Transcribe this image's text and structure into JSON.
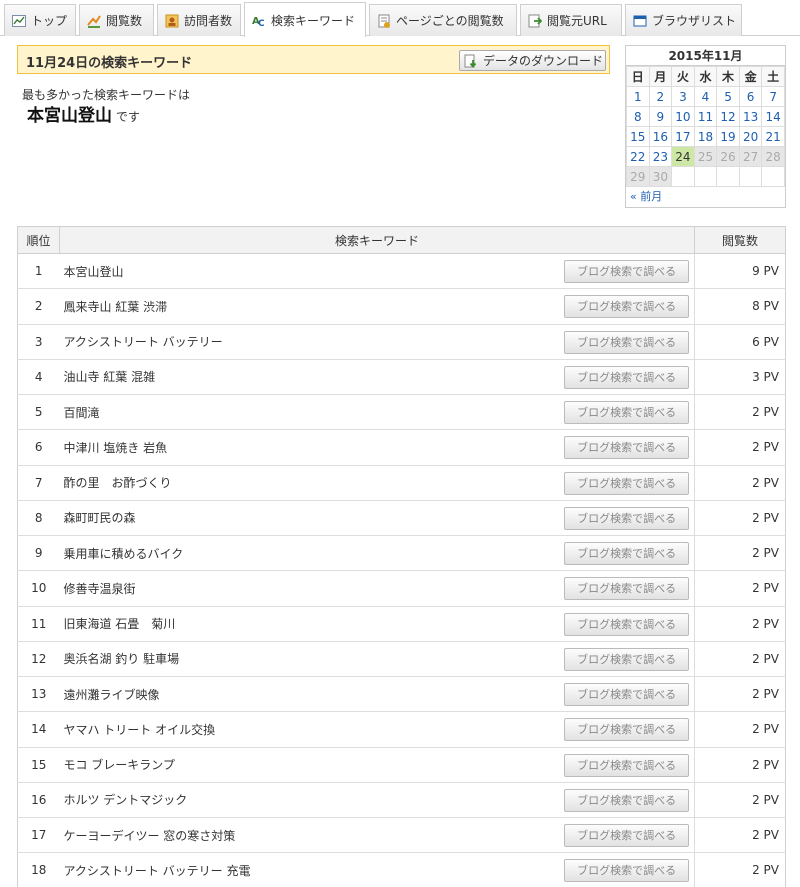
{
  "tabs": [
    {
      "label": "トップ",
      "icon": "chart-line-icon",
      "active": false
    },
    {
      "label": "閲覧数",
      "icon": "pageviews-icon",
      "active": false
    },
    {
      "label": "訪問者数",
      "icon": "visitors-icon",
      "active": false
    },
    {
      "label": "検索キーワード",
      "icon": "keyword-icon",
      "active": true
    },
    {
      "label": "ページごとの閲覧数",
      "icon": "page-icon",
      "active": false
    },
    {
      "label": "閲覧元URL",
      "icon": "referrer-icon",
      "active": false
    },
    {
      "label": "ブラウザリスト",
      "icon": "browser-icon",
      "active": false
    }
  ],
  "header": {
    "title": "11月24日の検索キーワード",
    "download_label": "データのダウンロード"
  },
  "summary": {
    "line1": "最も多かった検索キーワードは",
    "top_keyword": "本宮山登山",
    "suffix": "です"
  },
  "calendar": {
    "title": "2015年11月",
    "weekdays": [
      "日",
      "月",
      "火",
      "水",
      "木",
      "金",
      "土"
    ],
    "weeks": [
      [
        "1",
        "2",
        "3",
        "4",
        "5",
        "6",
        "7"
      ],
      [
        "8",
        "9",
        "10",
        "11",
        "12",
        "13",
        "14"
      ],
      [
        "15",
        "16",
        "17",
        "18",
        "19",
        "20",
        "21"
      ],
      [
        "22",
        "23",
        "24",
        "25",
        "26",
        "27",
        "28"
      ],
      [
        "29",
        "30",
        "",
        "",
        "",
        "",
        ""
      ]
    ],
    "today": "24",
    "prev_label": "前月"
  },
  "table": {
    "col_rank": "順位",
    "col_keyword": "検索キーワード",
    "col_views": "閲覧数",
    "button_label": "ブログ検索で調べる",
    "rows": [
      {
        "rank": "1",
        "keyword": "本宮山登山",
        "views": "9 PV"
      },
      {
        "rank": "2",
        "keyword": "鳳来寺山 紅葉 渋滞",
        "views": "8 PV"
      },
      {
        "rank": "3",
        "keyword": "アクシストリート バッテリー",
        "views": "6 PV"
      },
      {
        "rank": "4",
        "keyword": "油山寺 紅葉 混雑",
        "views": "3 PV"
      },
      {
        "rank": "5",
        "keyword": "百間滝",
        "views": "2 PV"
      },
      {
        "rank": "6",
        "keyword": "中津川 塩焼き 岩魚",
        "views": "2 PV"
      },
      {
        "rank": "7",
        "keyword": "酢の里　お酢づくり",
        "views": "2 PV"
      },
      {
        "rank": "8",
        "keyword": "森町町民の森",
        "views": "2 PV"
      },
      {
        "rank": "9",
        "keyword": "乗用車に積めるバイク",
        "views": "2 PV"
      },
      {
        "rank": "10",
        "keyword": "修善寺温泉街",
        "views": "2 PV"
      },
      {
        "rank": "11",
        "keyword": "旧東海道 石畳　菊川",
        "views": "2 PV"
      },
      {
        "rank": "12",
        "keyword": "奥浜名湖 釣り 駐車場",
        "views": "2 PV"
      },
      {
        "rank": "13",
        "keyword": "遠州灘ライブ映像",
        "views": "2 PV"
      },
      {
        "rank": "14",
        "keyword": "ヤマハ トリート オイル交換",
        "views": "2 PV"
      },
      {
        "rank": "15",
        "keyword": "モコ ブレーキランプ",
        "views": "2 PV"
      },
      {
        "rank": "16",
        "keyword": "ホルツ デントマジック",
        "views": "2 PV"
      },
      {
        "rank": "17",
        "keyword": "ケーヨーデイツー 窓の寒さ対策",
        "views": "2 PV"
      },
      {
        "rank": "18",
        "keyword": "アクシストリート バッテリー 充電",
        "views": "2 PV"
      }
    ]
  },
  "colors": {
    "title_bg": "#fff4cc",
    "title_border": "#f0c040",
    "today_bg": "#cde8a5",
    "link": "#1d5fb0"
  }
}
